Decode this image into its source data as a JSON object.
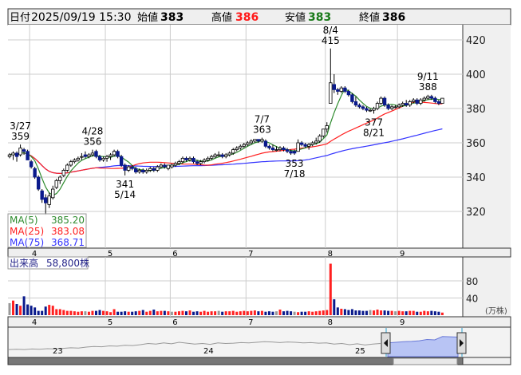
{
  "header": {
    "date_label": "日付",
    "datetime": "2025/09/19 15:30",
    "open_label": "始値",
    "open": "383",
    "high_label": "高値",
    "high": "386",
    "low_label": "安値",
    "low": "383",
    "close_label": "終値",
    "close": "386"
  },
  "legend": {
    "ma5_label": "MA(5)",
    "ma5_value": "385.20",
    "ma25_label": "MA(25)",
    "ma25_value": "383.08",
    "ma75_label": "MA(75)",
    "ma75_value": "368.71"
  },
  "volume_legend": {
    "label": "出来高",
    "value": "58,800株"
  },
  "volume_unit": "(万株)",
  "colors": {
    "up_volume": "#ff2020",
    "down_candle": "#0a1a8c",
    "flat_volume": "#999999",
    "ma5": "#2e8b2e",
    "ma25": "#ff2020",
    "ma75": "#3333ff"
  },
  "chart_data": {
    "type": "candlestick",
    "price_axis": {
      "ticks": [
        "420",
        "400",
        "380",
        "360",
        "340",
        "320"
      ],
      "range": [
        310,
        428
      ]
    },
    "volume_axis": {
      "ticks": [
        "80",
        "40"
      ],
      "unit": "万株"
    },
    "months": [
      {
        "label": "4",
        "start_index": 6
      },
      {
        "label": "5",
        "start_index": 27
      },
      {
        "label": "6",
        "start_index": 45
      },
      {
        "label": "7",
        "start_index": 66
      },
      {
        "label": "8",
        "start_index": 88
      },
      {
        "label": "9",
        "start_index": 108
      }
    ],
    "annotations": [
      {
        "date": "3/27",
        "value": "359",
        "index": 3,
        "price": 359,
        "pos": "above"
      },
      {
        "date": "4/28",
        "value": "356",
        "index": 23,
        "price": 356,
        "pos": "above"
      },
      {
        "date": "5/14",
        "value": "341",
        "index": 32,
        "price": 341,
        "pos": "below"
      },
      {
        "date": "7/7",
        "value": "363",
        "index": 70,
        "price": 363,
        "pos": "above"
      },
      {
        "date": "7/18",
        "value": "353",
        "index": 79,
        "price": 353,
        "pos": "below"
      },
      {
        "date": "8/4",
        "value": "415",
        "index": 89,
        "price": 415,
        "pos": "above"
      },
      {
        "date": "8/21",
        "value": "377",
        "index": 101,
        "price": 377,
        "pos": "below"
      },
      {
        "date": "9/11",
        "value": "388",
        "index": 116,
        "price": 388,
        "pos": "above"
      }
    ],
    "ohlc": [
      [
        352,
        354,
        351,
        353
      ],
      [
        353,
        355,
        350,
        354
      ],
      [
        354,
        355,
        349,
        352
      ],
      [
        353,
        359,
        352,
        357
      ],
      [
        356,
        357,
        353,
        355
      ],
      [
        355,
        356,
        350,
        350
      ],
      [
        349,
        350,
        345,
        346
      ],
      [
        345,
        346,
        339,
        340
      ],
      [
        340,
        341,
        332,
        333
      ],
      [
        332,
        333,
        325,
        327
      ],
      [
        328,
        330,
        318,
        325
      ],
      [
        324,
        331,
        322,
        329
      ],
      [
        328,
        335,
        327,
        333
      ],
      [
        334,
        339,
        333,
        338
      ],
      [
        338,
        341,
        336,
        340
      ],
      [
        341,
        345,
        340,
        344
      ],
      [
        344,
        348,
        343,
        347
      ],
      [
        347,
        350,
        346,
        349
      ],
      [
        349,
        351,
        348,
        350
      ],
      [
        350,
        352,
        349,
        351
      ],
      [
        352,
        354,
        350,
        352
      ],
      [
        353,
        355,
        351,
        352
      ],
      [
        352,
        354,
        351,
        353
      ],
      [
        353,
        356,
        352,
        354
      ],
      [
        355,
        356,
        351,
        352
      ],
      [
        352,
        353,
        349,
        350
      ],
      [
        350,
        352,
        349,
        351
      ],
      [
        351,
        353,
        349,
        352
      ],
      [
        352,
        354,
        350,
        353
      ],
      [
        353,
        356,
        352,
        355
      ],
      [
        355,
        356,
        351,
        352
      ],
      [
        352,
        353,
        346,
        347
      ],
      [
        347,
        348,
        341,
        344
      ],
      [
        344,
        347,
        343,
        346
      ],
      [
        346,
        347,
        344,
        345
      ],
      [
        345,
        346,
        342,
        343
      ],
      [
        343,
        345,
        342,
        344
      ],
      [
        344,
        345,
        342,
        343
      ],
      [
        343,
        345,
        342,
        344
      ],
      [
        344,
        346,
        343,
        345
      ],
      [
        345,
        346,
        343,
        344
      ],
      [
        344,
        347,
        343,
        346
      ],
      [
        346,
        348,
        345,
        347
      ],
      [
        347,
        348,
        345,
        346
      ],
      [
        345,
        347,
        344,
        347
      ],
      [
        346,
        348,
        345,
        347
      ],
      [
        347,
        349,
        346,
        348
      ],
      [
        348,
        350,
        347,
        349
      ],
      [
        349,
        352,
        348,
        351
      ],
      [
        351,
        352,
        349,
        350
      ],
      [
        350,
        352,
        349,
        351
      ],
      [
        351,
        352,
        348,
        349
      ],
      [
        349,
        350,
        347,
        348
      ],
      [
        348,
        350,
        347,
        349
      ],
      [
        349,
        351,
        348,
        350
      ],
      [
        350,
        352,
        349,
        351
      ],
      [
        351,
        353,
        350,
        352
      ],
      [
        352,
        354,
        351,
        353
      ],
      [
        353,
        355,
        352,
        353
      ],
      [
        353,
        354,
        351,
        352
      ],
      [
        352,
        354,
        351,
        353
      ],
      [
        353,
        355,
        352,
        354
      ],
      [
        354,
        357,
        353,
        356
      ],
      [
        356,
        358,
        355,
        357
      ],
      [
        357,
        359,
        356,
        358
      ],
      [
        358,
        360,
        357,
        359
      ],
      [
        359,
        361,
        358,
        360
      ],
      [
        360,
        362,
        359,
        361
      ],
      [
        361,
        362,
        360,
        362
      ],
      [
        362,
        362,
        360,
        361
      ],
      [
        361,
        363,
        360,
        362
      ],
      [
        361,
        362,
        357,
        358
      ],
      [
        358,
        359,
        356,
        357
      ],
      [
        357,
        359,
        355,
        356
      ],
      [
        356,
        358,
        355,
        356
      ],
      [
        356,
        358,
        355,
        357
      ],
      [
        357,
        358,
        355,
        356
      ],
      [
        356,
        357,
        354,
        355
      ],
      [
        355,
        356,
        353,
        354
      ],
      [
        355,
        356,
        353,
        354
      ],
      [
        355,
        362,
        355,
        360
      ],
      [
        360,
        361,
        358,
        359
      ],
      [
        359,
        360,
        357,
        358
      ],
      [
        358,
        360,
        356,
        359
      ],
      [
        359,
        361,
        358,
        360
      ],
      [
        360,
        363,
        359,
        361
      ],
      [
        361,
        365,
        360,
        364
      ],
      [
        364,
        368,
        363,
        368
      ],
      [
        368,
        372,
        366,
        370
      ],
      [
        383,
        415,
        383,
        395
      ],
      [
        394,
        400,
        389,
        391
      ],
      [
        391,
        392,
        388,
        390
      ],
      [
        390,
        393,
        389,
        392
      ],
      [
        392,
        393,
        389,
        390
      ],
      [
        390,
        391,
        387,
        388
      ],
      [
        388,
        389,
        383,
        384
      ],
      [
        384,
        387,
        381,
        382
      ],
      [
        382,
        383,
        380,
        381
      ],
      [
        381,
        382,
        379,
        380
      ],
      [
        380,
        381,
        378,
        379
      ],
      [
        379,
        380,
        378,
        379
      ],
      [
        379,
        381,
        377,
        380
      ],
      [
        380,
        384,
        379,
        383
      ],
      [
        383,
        387,
        382,
        386
      ],
      [
        386,
        387,
        381,
        382
      ],
      [
        382,
        383,
        379,
        380
      ],
      [
        380,
        382,
        379,
        381
      ],
      [
        381,
        382,
        380,
        381
      ],
      [
        381,
        383,
        380,
        382
      ],
      [
        382,
        384,
        381,
        383
      ],
      [
        383,
        385,
        381,
        382
      ],
      [
        382,
        385,
        381,
        384
      ],
      [
        384,
        386,
        383,
        385
      ],
      [
        385,
        386,
        382,
        383
      ],
      [
        383,
        386,
        382,
        385
      ],
      [
        385,
        387,
        384,
        386
      ],
      [
        386,
        388,
        385,
        387
      ],
      [
        387,
        388,
        385,
        386
      ],
      [
        386,
        387,
        383,
        384
      ],
      [
        384,
        385,
        382,
        383
      ],
      [
        383,
        386,
        383,
        386
      ]
    ],
    "volume": [
      28,
      34,
      26,
      22,
      44,
      25,
      22,
      18,
      10,
      10,
      20,
      24,
      22,
      14,
      14,
      12,
      10,
      10,
      9,
      8,
      9,
      9,
      8,
      10,
      10,
      12,
      10,
      9,
      7,
      14,
      8,
      8,
      9,
      8,
      8,
      9,
      10,
      12,
      8,
      10,
      13,
      9,
      10,
      10,
      9,
      8,
      8,
      9,
      10,
      9,
      11,
      8,
      9,
      8,
      10,
      8,
      9,
      9,
      10,
      8,
      9,
      9,
      10,
      8,
      9,
      10,
      9,
      10,
      11,
      9,
      10,
      8,
      9,
      8,
      9,
      13,
      9,
      10,
      9,
      8,
      7,
      8,
      8,
      9,
      8,
      9,
      10,
      11,
      12,
      120,
      37,
      18,
      15,
      14,
      12,
      14,
      11,
      11,
      10,
      10,
      12,
      11,
      13,
      11,
      11,
      10,
      10,
      9,
      10,
      9,
      9,
      10,
      10,
      8,
      8,
      10,
      9,
      10,
      9,
      8,
      6
    ]
  },
  "navigator": {
    "year_labels": [
      "23",
      "24",
      "25"
    ],
    "series": [
      300,
      301,
      300,
      302,
      301,
      303,
      302,
      304,
      306,
      305,
      308,
      310,
      309,
      312,
      311,
      314,
      313,
      316,
      320,
      318,
      322,
      319,
      324,
      321,
      318,
      320,
      317,
      322,
      320,
      321,
      323,
      322,
      324,
      326,
      325,
      323,
      325,
      324,
      322,
      323,
      321,
      322,
      318,
      320,
      316,
      319,
      315,
      318,
      320,
      322,
      324,
      326,
      327,
      329,
      333,
      332,
      343,
      342,
      341
    ]
  }
}
